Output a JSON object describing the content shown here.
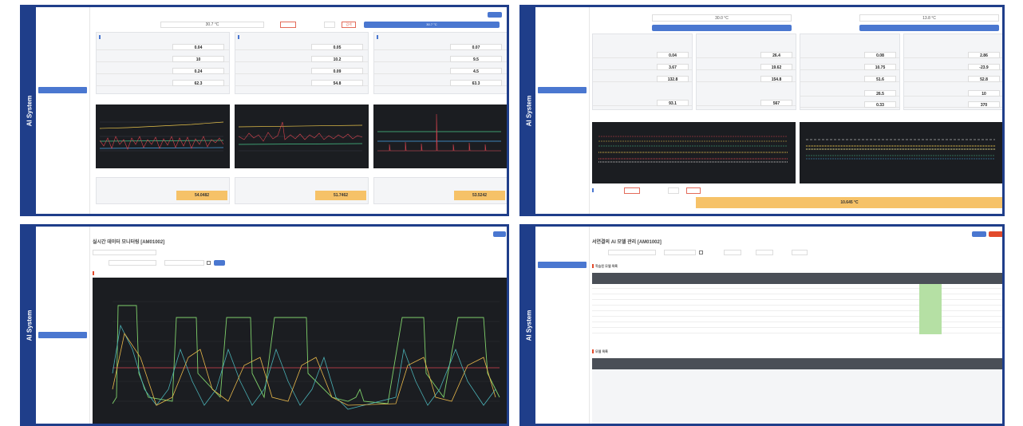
{
  "app": {
    "sidebar_title": "AI System"
  },
  "panel_tl": {
    "top_value": "30.7 °C",
    "header_button": "검색",
    "status_bar": "30.7 °C",
    "cards": [
      {
        "rows": [
          {
            "value": "0.04"
          },
          {
            "value": "10"
          },
          {
            "value": "0.24"
          },
          {
            "value": "62.3"
          }
        ]
      },
      {
        "rows": [
          {
            "value": "0.05"
          },
          {
            "value": "10.2"
          },
          {
            "value": "0.09"
          },
          {
            "value": "54.8"
          }
        ]
      },
      {
        "rows": [
          {
            "value": "0.07"
          },
          {
            "value": "9.5"
          },
          {
            "value": "4.5"
          },
          {
            "value": "63.3"
          }
        ]
      }
    ],
    "result_values": [
      "54.0482",
      "51.7462",
      "53.5242"
    ]
  },
  "panel_tr": {
    "top_values": [
      "30.0 °C",
      "13.8 °C"
    ],
    "cards": [
      {
        "rows": [
          {
            "value": "0.04"
          },
          {
            "value": "3.67"
          },
          {
            "value": "132.8"
          }
        ],
        "extra": "93.1"
      },
      {
        "rows": [
          {
            "value": "26.4"
          },
          {
            "value": "19.62"
          },
          {
            "value": "154.8"
          }
        ],
        "extra": "567"
      },
      {
        "rows": [
          {
            "value": "0.08"
          },
          {
            "value": "10.75"
          },
          {
            "value": "51.6"
          },
          {
            "value": "26.5"
          },
          {
            "value": "0.33"
          }
        ]
      },
      {
        "rows": [
          {
            "value": "2.86"
          },
          {
            "value": "-23.9"
          },
          {
            "value": "52.8"
          },
          {
            "value": "10"
          },
          {
            "value": "370"
          }
        ]
      }
    ],
    "result_value": "10.645 °C"
  },
  "panel_bl": {
    "page_title": "실시간 데이터 모니터링 [AM01002]"
  },
  "panel_br": {
    "page_title": "서연결의 AI 모델 관리 [AM01002]",
    "section1": "학습된 모델 목록",
    "section2": "모델 목록"
  },
  "colors": {
    "brand": "#1f3e8a",
    "accent": "#4a77d0",
    "highlight": "#f6c268",
    "chart_bg": "#1b1d21",
    "status_ok": "#b5e0a4"
  },
  "icons": [
    "calendar-icon",
    "search-icon"
  ]
}
